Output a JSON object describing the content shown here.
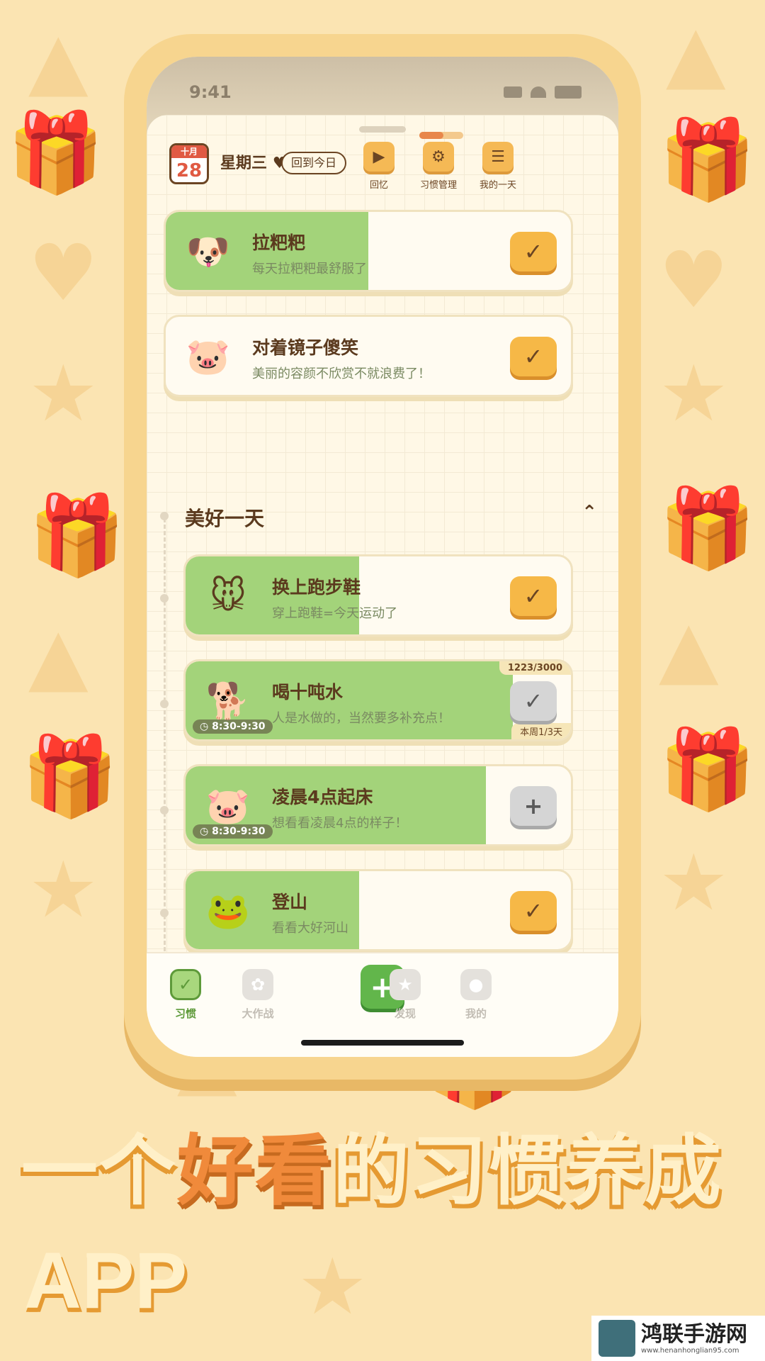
{
  "background": {
    "color": "#fbe4b2",
    "pattern_color": "#f6d394"
  },
  "calendar": {
    "month": "十月",
    "day": "28",
    "weekday": "星期三",
    "today_button": "回到今日"
  },
  "top_actions": [
    {
      "label": "回忆",
      "icon": "video-icon"
    },
    {
      "label": "习惯管理",
      "icon": "settings-icon"
    },
    {
      "label": "我的一天",
      "icon": "list-icon"
    }
  ],
  "habits": [
    {
      "title": "拉粑粑",
      "subtitle": "每天拉粑粑最舒服了",
      "avatar": "🐶",
      "progress": 0.5,
      "status": "done"
    },
    {
      "title": "对着镜子傻笑",
      "subtitle": "美丽的容颜不欣赏不就浪费了！",
      "avatar": "🐷",
      "progress": 0,
      "status": "done"
    }
  ],
  "section": {
    "title": "美好一天",
    "habits": [
      {
        "title": "换上跑步鞋",
        "subtitle": "穿上跑鞋=今天运动了",
        "avatar": "🐭",
        "progress": 0.45,
        "status": "done"
      },
      {
        "title": "喝十吨水",
        "subtitle": "人是水做的，当然要多补充点！",
        "avatar": "🐕",
        "progress": 0.85,
        "status": "partial",
        "time": "8:30-9:30",
        "count": "1223/3000",
        "week": "本周1/3天"
      },
      {
        "title": "凌晨4点起床",
        "subtitle": "想看看凌晨4点的样子！",
        "avatar": "🐷",
        "progress": 0.78,
        "status": "add",
        "time": "8:30-9:30"
      },
      {
        "title": "登山",
        "subtitle": "看看大好河山",
        "avatar": "🐸",
        "progress": 0.45,
        "status": "done"
      }
    ]
  },
  "tabs": [
    {
      "label": "习惯",
      "icon": "habit-icon",
      "active": true
    },
    {
      "label": "大作战",
      "icon": "paw-icon",
      "active": false
    },
    {
      "label": "发现",
      "icon": "planet-icon",
      "active": false
    },
    {
      "label": "我的",
      "icon": "profile-icon",
      "active": false
    }
  ],
  "headline": {
    "part1": "一个",
    "highlight": "好看",
    "part2": "的习惯养成",
    "line2": "APP"
  },
  "watermark": {
    "text": "鸿联手游网",
    "url": "www.henanhonglian95.com"
  }
}
